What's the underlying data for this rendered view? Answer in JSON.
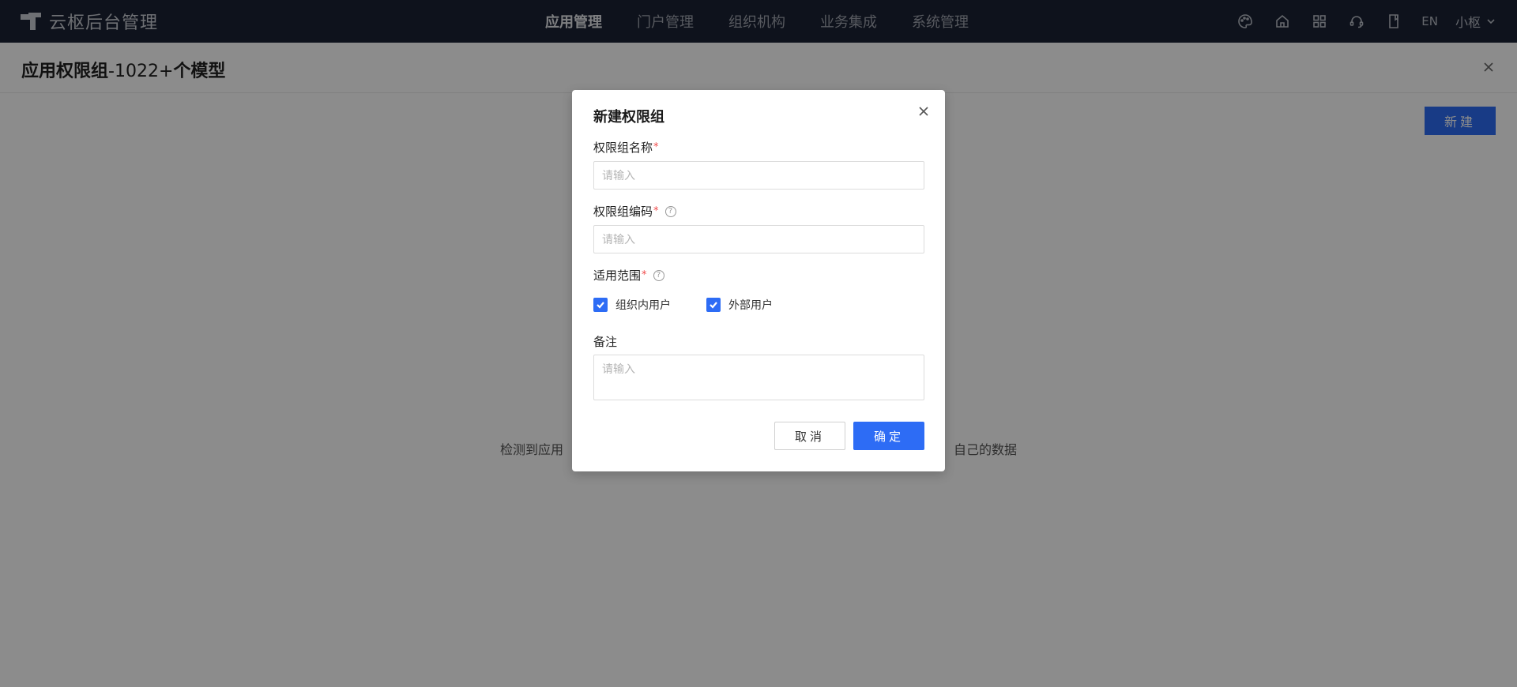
{
  "app": {
    "title": "云枢后台管理"
  },
  "nav": {
    "items": [
      {
        "label": "应用管理",
        "active": true
      },
      {
        "label": "门户管理"
      },
      {
        "label": "组织机构"
      },
      {
        "label": "业务集成"
      },
      {
        "label": "系统管理"
      }
    ]
  },
  "toolbar": {
    "icons": [
      "palette-icon",
      "home-icon",
      "grid-apps-icon",
      "headset-icon",
      "book-icon"
    ],
    "lang": "EN",
    "user": "小枢"
  },
  "page": {
    "title_bold": "应用权限组",
    "title_rest": "-1022+",
    "title_suffix": "个模型",
    "new_button": "新建",
    "empty_left": "检测到应用",
    "empty_right": "自己的数据"
  },
  "modal": {
    "title": "新建权限组",
    "fields": {
      "name": {
        "label": "权限组名称",
        "required": "*",
        "placeholder": "请输入"
      },
      "code": {
        "label": "权限组编码",
        "required": "*",
        "placeholder": "请输入"
      },
      "scope": {
        "label": "适用范围",
        "required": "*",
        "options": [
          {
            "label": "组织内用户",
            "checked": true
          },
          {
            "label": "外部用户",
            "checked": true
          }
        ]
      },
      "remark": {
        "label": "备注",
        "placeholder": "请输入"
      }
    },
    "cancel": "取消",
    "confirm": "确定"
  },
  "colors": {
    "primary": "#2d6cf5",
    "topbar": "#1b2234",
    "required": "#f04a4a"
  }
}
